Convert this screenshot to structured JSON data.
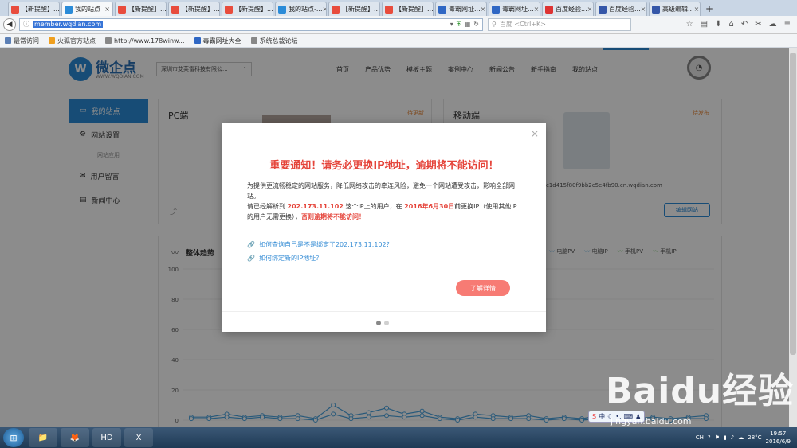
{
  "browser": {
    "tabs": [
      {
        "label": "【新提醒】...",
        "icon_color": "#e84c3d"
      },
      {
        "label": "我的站点",
        "icon_color": "#2a8bd8",
        "active": true
      },
      {
        "label": "【新提醒】...",
        "icon_color": "#e84c3d"
      },
      {
        "label": "【新提醒】...",
        "icon_color": "#e84c3d"
      },
      {
        "label": "【新提醒】...",
        "icon_color": "#e84c3d"
      },
      {
        "label": "我的站点-...",
        "icon_color": "#2a8bd8"
      },
      {
        "label": "【新提醒】...",
        "icon_color": "#e84c3d"
      },
      {
        "label": "【新提醒】...",
        "icon_color": "#e84c3d"
      },
      {
        "label": "毒霸网址...",
        "icon_color": "#2f67c4"
      },
      {
        "label": "毒霸网址...",
        "icon_color": "#2f67c4"
      },
      {
        "label": "百度经验...",
        "icon_color": "#d33"
      },
      {
        "label": "百度经验...",
        "icon_color": "#3456a8"
      },
      {
        "label": "高级编辑...",
        "icon_color": "#3456a8"
      }
    ],
    "tab_close": "×",
    "new_tab": "+",
    "url": "member.wqdian.com",
    "search_placeholder": "百度 <Ctrl+K>",
    "bookmarks": [
      {
        "label": "最常访问",
        "color": "#5b7fb5"
      },
      {
        "label": "火狐官方站点",
        "color": "#f0a020"
      },
      {
        "label": "http://www.178winw...",
        "color": "#888"
      },
      {
        "label": "毒霸网址大全",
        "color": "#2f67c4"
      },
      {
        "label": "系统总裁论坛",
        "color": "#888"
      }
    ]
  },
  "site": {
    "logo_mark": "W",
    "logo_text": "微企点",
    "logo_sub": "WWW.WQDIAN.COM",
    "company": "深圳市艾莱雷科技有限公...",
    "nav": [
      "首页",
      "产品优势",
      "模板主题",
      "案例中心",
      "新闻公告",
      "新手指南",
      "我的站点"
    ],
    "sidebar": [
      {
        "label": "我的站点",
        "icon": "monitor-icon",
        "glyph": "▭",
        "active": true
      },
      {
        "label": "网站设置",
        "icon": "gear-icon",
        "glyph": "⚙"
      },
      {
        "caption": "网站应用"
      },
      {
        "label": "用户留言",
        "icon": "message-icon",
        "glyph": "✉"
      },
      {
        "label": "新闻中心",
        "icon": "news-icon",
        "glyph": "▤"
      }
    ],
    "pc_title": "PC端",
    "pc_status": "待更新",
    "mobile_title": "移动端",
    "mobile_status": "待发布",
    "mobile_url": "c1d415f80f9bb2c5e4fb90.cn.wqdian.com",
    "edit_button": "编辑网站",
    "trend_title": "整体趋势",
    "trend_legend": [
      "电脑PV",
      "电脑IP",
      "手机PV",
      "手机IP"
    ]
  },
  "chart_data": {
    "type": "line",
    "title": "整体趋势",
    "ylim": [
      0,
      100
    ],
    "yticks": [
      0,
      20,
      40,
      60,
      80,
      100
    ],
    "grid": true,
    "legend_position": "top-right",
    "series": [
      {
        "name": "电脑PV",
        "color": "#4aa3df",
        "values": [
          2,
          2,
          4,
          2,
          3,
          2,
          3,
          1,
          10,
          3,
          5,
          8,
          4,
          6,
          2,
          1,
          4,
          3,
          2,
          3,
          1,
          2,
          1,
          3,
          2,
          1,
          2,
          1,
          2,
          3
        ]
      },
      {
        "name": "电脑IP",
        "color": "#4aa3df",
        "values": [
          1,
          1,
          2,
          1,
          2,
          1,
          1,
          0,
          4,
          1,
          2,
          3,
          2,
          3,
          1,
          0,
          2,
          1,
          1,
          1,
          0,
          1,
          0,
          1,
          1,
          0,
          1,
          0,
          1,
          1
        ]
      }
    ]
  },
  "modal": {
    "title": "重要通知！请务必更换IP地址，逾期将不能访问！",
    "para1": "为提供更流畅稳定的网站服务，降低网络攻击的牵连风险，避免一个网站遭受攻击，影响全部网站。",
    "para2_a": "请已经解析到",
    "ip": "202.173.11.102",
    "para2_b": "这个IP上的用户，在",
    "deadline": "2016年6月30日",
    "para2_c": "前更换IP（使用其他IP的用户无需更换），",
    "warning": "否则逾期将不能访问！",
    "link1": "如何查询自己是不是绑定了202.173.11.102？",
    "link2": "如何绑定新的IP地址？",
    "button": "了解详情",
    "close": "×"
  },
  "watermark": {
    "text": "Baidu经验",
    "url": "jingyan.baidu.com"
  },
  "ime": {
    "label": "中"
  },
  "taskbar": {
    "apps": [
      "📁",
      "🦊",
      "HD",
      "X"
    ],
    "temperature": "28°C",
    "lang": "CH",
    "time": "19:57",
    "date": "2016/6/9"
  }
}
